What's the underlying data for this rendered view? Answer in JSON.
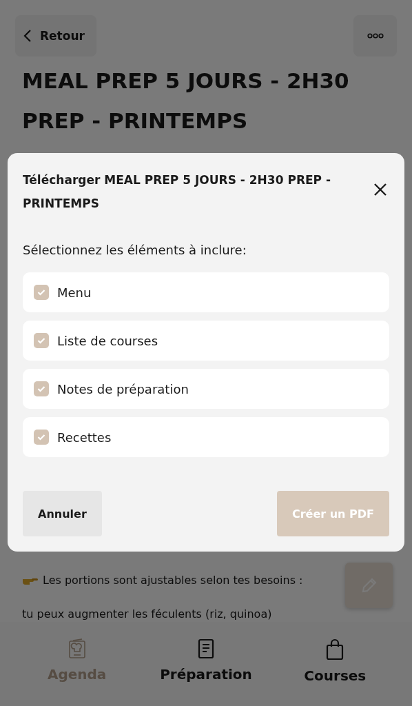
{
  "header": {
    "back_label": "Retour"
  },
  "recipe": {
    "title": "MEAL PREP 5 JOURS - 2H30 PREP - PRINTEMPS",
    "notes": [
      {
        "kind": "pointer",
        "text": "Les portions sont ajustables selon tes besoins :"
      },
      {
        "kind": "plain",
        "text": "tu peux augmenter les féculents (riz, quinoa)"
      }
    ]
  },
  "dialog": {
    "title": "Télécharger MEAL PREP 5 JOURS - 2H30 PREP - PRINTEMPS",
    "prompt": "Sélectionnez les éléments à inclure:",
    "options": [
      {
        "label": "Menu",
        "checked": true
      },
      {
        "label": "Liste de courses",
        "checked": true
      },
      {
        "label": "Notes de préparation",
        "checked": true
      },
      {
        "label": "Recettes",
        "checked": true
      }
    ],
    "buttons": [
      {
        "label": "Annuler",
        "kind": "secondary"
      },
      {
        "label": "Créer un PDF",
        "kind": "primary"
      }
    ]
  },
  "nav": [
    {
      "label": "Agenda",
      "kind": "chef",
      "selected": true
    },
    {
      "label": "Préparation",
      "kind": "document",
      "selected": false
    },
    {
      "label": "Courses",
      "kind": "bag",
      "selected": false
    }
  ]
}
